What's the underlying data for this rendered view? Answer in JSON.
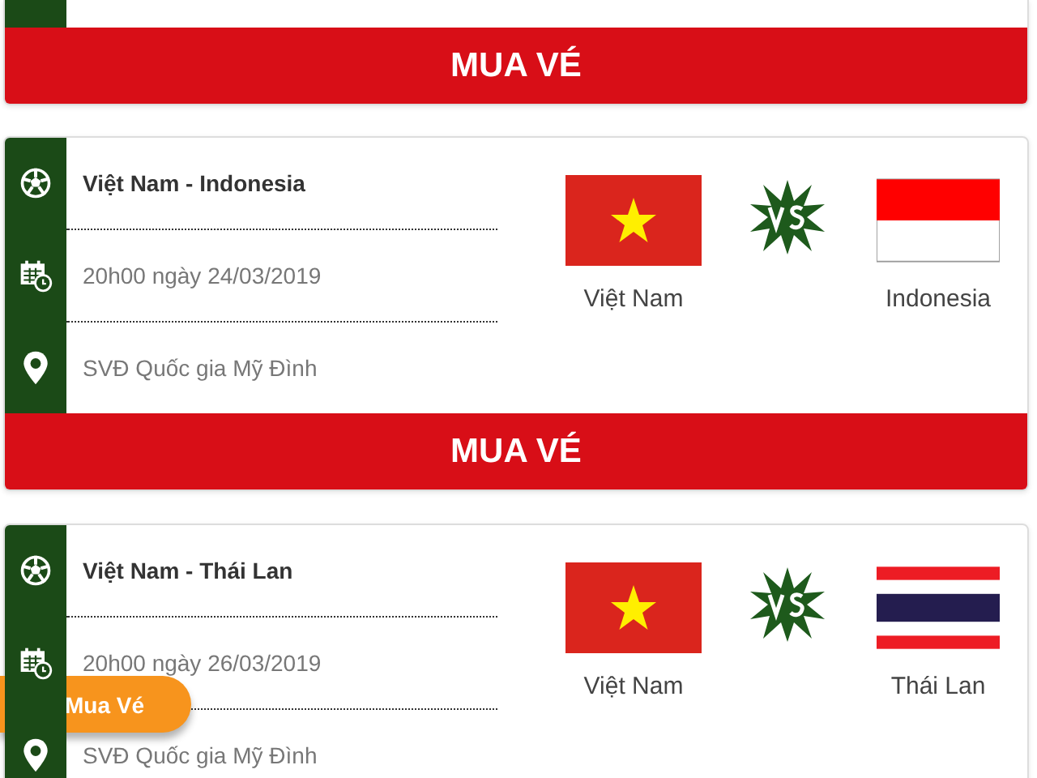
{
  "matches": [
    {
      "kind": "cut",
      "buy_label": "MUA VÉ"
    },
    {
      "kind": "full",
      "title": "Việt Nam - Indonesia",
      "time": "20h00 ngày 24/03/2019",
      "venue": "SVĐ Quốc gia Mỹ Đình",
      "home": {
        "name": "Việt Nam",
        "kind": "vn"
      },
      "away": {
        "name": "Indonesia",
        "kind": "id"
      },
      "buy_label": "MUA VÉ"
    },
    {
      "kind": "full",
      "title": "Việt Nam - Thái Lan",
      "time": "20h00 ngày 26/03/2019",
      "venue": "SVĐ Quốc gia Mỹ Đình",
      "home": {
        "name": "Việt Nam",
        "kind": "vn"
      },
      "away": {
        "name": "Thái Lan",
        "kind": "th"
      }
    }
  ],
  "floating_button": "Mua Vé"
}
